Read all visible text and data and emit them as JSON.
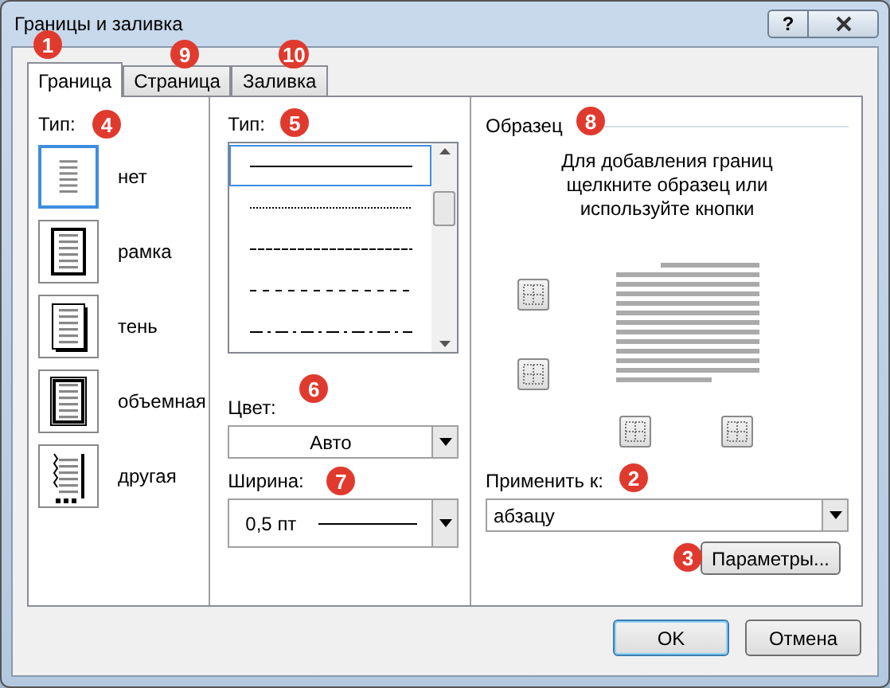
{
  "window": {
    "title": "Границы и заливка",
    "help": "?"
  },
  "tabs": [
    {
      "label": "Граница",
      "selected": true,
      "marker": "1"
    },
    {
      "label": "Страница",
      "selected": false,
      "marker": "9"
    },
    {
      "label": "Заливка",
      "selected": false,
      "marker": "10"
    }
  ],
  "setting": {
    "label": "Тип:",
    "marker": "4",
    "items": [
      {
        "label": "нет",
        "kind": "none",
        "selected": true
      },
      {
        "label": "рамка",
        "kind": "box",
        "selected": false
      },
      {
        "label": "тень",
        "kind": "shadow",
        "selected": false
      },
      {
        "label": "объемная",
        "kind": "double",
        "selected": false
      },
      {
        "label": "другая",
        "kind": "custom",
        "selected": false
      }
    ]
  },
  "style": {
    "label": "Тип:",
    "marker": "5",
    "items": [
      {
        "kind": "solid",
        "selected": true
      },
      {
        "kind": "dotted",
        "selected": false
      },
      {
        "kind": "dense-dash",
        "selected": false
      },
      {
        "kind": "dashed",
        "selected": false
      },
      {
        "kind": "dash-dot",
        "selected": false
      }
    ]
  },
  "color": {
    "label": "Цвет:",
    "value": "Авто",
    "marker": "6"
  },
  "width": {
    "label": "Ширина:",
    "value": "0,5 пт",
    "marker": "7"
  },
  "preview": {
    "title": "Образец",
    "marker": "8",
    "hint": "Для добавления границ щелкните образец или используйте кнопки"
  },
  "apply_to": {
    "label": "Применить к:",
    "value": "абзацу",
    "marker": "2"
  },
  "options_button": {
    "label": "Параметры...",
    "marker": "3"
  },
  "buttons": [
    {
      "label": "OK",
      "default": true
    },
    {
      "label": "Отмена",
      "default": false
    }
  ]
}
